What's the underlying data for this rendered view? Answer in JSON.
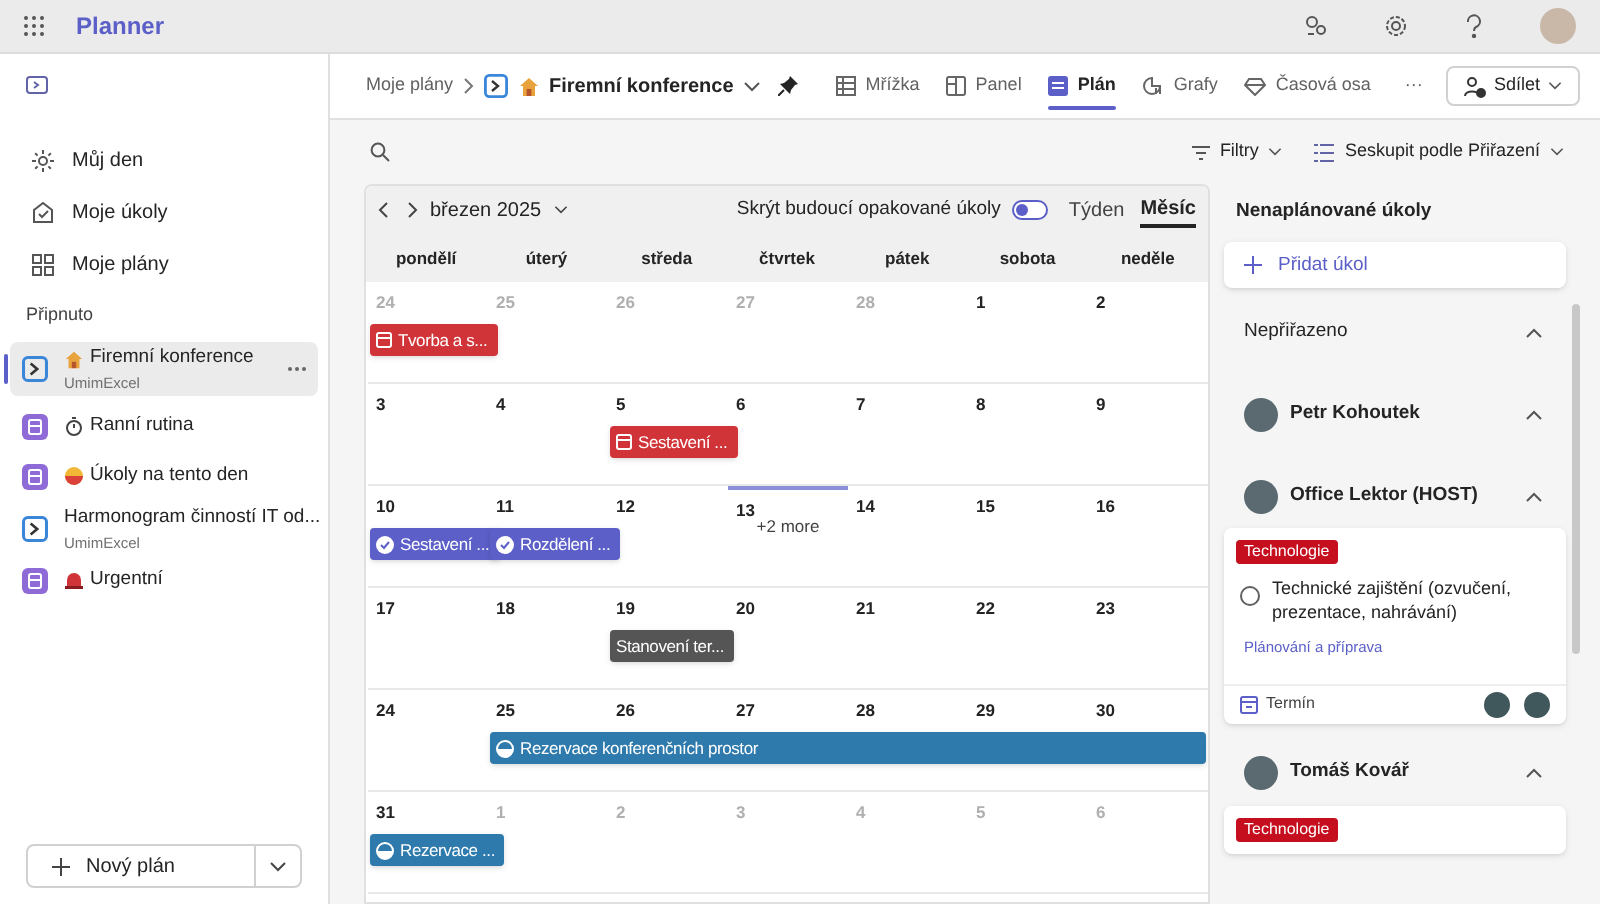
{
  "app": {
    "title": "Planner"
  },
  "sidebar": {
    "nav": [
      {
        "label": "Můj den"
      },
      {
        "label": "Moje úkoly"
      },
      {
        "label": "Moje plány"
      }
    ],
    "pinned_heading": "Připnuto",
    "pinned": [
      {
        "name": "Firemní konference",
        "owner": "UmimExcel",
        "kind": "premium",
        "selected": true
      },
      {
        "name": "Ranní rutina",
        "kind": "basic",
        "selected": false
      },
      {
        "name": "Úkoly na tento den",
        "kind": "basic",
        "selected": false
      },
      {
        "name": "Harmonogram činností IT od...",
        "owner": "UmimExcel",
        "kind": "premium",
        "selected": false
      },
      {
        "name": "Urgentní",
        "kind": "basic",
        "selected": false
      }
    ],
    "new_plan": "Nový plán"
  },
  "header": {
    "breadcrumb_root": "Moje plány",
    "plan_name": "Firemní konference",
    "tabs": [
      {
        "label": "Mřížka",
        "selected": false
      },
      {
        "label": "Panel",
        "selected": false
      },
      {
        "label": "Plán",
        "selected": true
      },
      {
        "label": "Grafy",
        "selected": false
      },
      {
        "label": "Časová osa",
        "selected": false
      }
    ],
    "more": "···",
    "share": "Sdílet"
  },
  "toolbar": {
    "filters": "Filtry",
    "group_by": "Seskupit podle Přiřazení"
  },
  "calendar": {
    "month": "březen 2025",
    "hide_recurring": "Skrýt budoucí opakované úkoly",
    "hide_recurring_on": false,
    "views": [
      {
        "label": "Týden",
        "selected": false
      },
      {
        "label": "Měsíc",
        "selected": true
      }
    ],
    "weekdays": [
      "pondělí",
      "úterý",
      "středa",
      "čtvrtek",
      "pátek",
      "sobota",
      "neděle"
    ],
    "weeks": [
      {
        "days": [
          {
            "n": "24",
            "other_month": true,
            "events": [
              {
                "text": "Tvorba a s...",
                "kind": "calendar",
                "multi_day": false
              }
            ]
          },
          {
            "n": "25",
            "other_month": true
          },
          {
            "n": "26",
            "other_month": true
          },
          {
            "n": "27",
            "other_month": true
          },
          {
            "n": "28",
            "other_month": true
          },
          {
            "n": "1",
            "other_month": false
          },
          {
            "n": "2",
            "other_month": false
          }
        ]
      },
      {
        "days": [
          {
            "n": "3",
            "other_month": false
          },
          {
            "n": "4",
            "other_month": false
          },
          {
            "n": "5",
            "other_month": false,
            "events": [
              {
                "text": "Sestavení ...",
                "kind": "calendar",
                "multi_day": false
              }
            ]
          },
          {
            "n": "6",
            "other_month": false
          },
          {
            "n": "7",
            "other_month": false
          },
          {
            "n": "8",
            "other_month": false
          },
          {
            "n": "9",
            "other_month": false
          }
        ]
      },
      {
        "days": [
          {
            "n": "10",
            "other_month": false,
            "events": [
              {
                "text": "Sestavení ...",
                "kind": "done",
                "multi_day": false
              }
            ]
          },
          {
            "n": "11",
            "other_month": false,
            "events": [
              {
                "text": "Rozdělení ...",
                "kind": "done",
                "multi_day": false
              }
            ]
          },
          {
            "n": "12",
            "other_month": false
          },
          {
            "n": "13",
            "other_month": false,
            "today": true,
            "events": [
              {
                "text": "+2 more",
                "kind": "more",
                "multi_day": false
              }
            ]
          },
          {
            "n": "14",
            "other_month": false
          },
          {
            "n": "15",
            "other_month": false
          },
          {
            "n": "16",
            "other_month": false
          }
        ]
      },
      {
        "days": [
          {
            "n": "17",
            "other_month": false
          },
          {
            "n": "18",
            "other_month": false
          },
          {
            "n": "19",
            "other_month": false,
            "events": [
              {
                "text": "Stanovení ter...",
                "kind": "plain",
                "multi_day": false
              }
            ]
          },
          {
            "n": "20",
            "other_month": false
          },
          {
            "n": "21",
            "other_month": false
          },
          {
            "n": "22",
            "other_month": false
          },
          {
            "n": "23",
            "other_month": false
          }
        ]
      },
      {
        "days": [
          {
            "n": "24",
            "other_month": false
          },
          {
            "n": "25",
            "other_month": false,
            "events": [
              {
                "text": "Rezervace konferenčních prostor",
                "kind": "progress",
                "multi_day": true
              }
            ]
          },
          {
            "n": "26",
            "other_month": false
          },
          {
            "n": "27",
            "other_month": false
          },
          {
            "n": "28",
            "other_month": false
          },
          {
            "n": "29",
            "other_month": false
          },
          {
            "n": "30",
            "other_month": false
          }
        ]
      },
      {
        "days": [
          {
            "n": "31",
            "other_month": false,
            "events": [
              {
                "text": "Rezervace ...",
                "kind": "progress",
                "multi_day": false
              }
            ]
          },
          {
            "n": "1",
            "other_month": true
          },
          {
            "n": "2",
            "other_month": true
          },
          {
            "n": "3",
            "other_month": true
          },
          {
            "n": "4",
            "other_month": true
          },
          {
            "n": "5",
            "other_month": true
          },
          {
            "n": "6",
            "other_month": true
          }
        ]
      }
    ]
  },
  "unscheduled": {
    "title": "Nenaplánované úkoly",
    "add_task": "Přidat úkol",
    "groups": [
      {
        "name": "Nepřiřazeno",
        "kind": "unassigned",
        "expanded": true
      },
      {
        "name": "Petr Kohoutek",
        "kind": "person",
        "expanded": true
      },
      {
        "name": "Office Lektor (HOST)",
        "kind": "person",
        "expanded": true,
        "tasks": [
          {
            "tag": "Technologie",
            "title": "Technické zajištění (ozvučení, prezentace, nahrávání)",
            "checked": false,
            "bucket": "Plánování a příprava",
            "due": "Termín"
          }
        ]
      },
      {
        "name": "Tomáš Kovář",
        "kind": "person",
        "expanded": true,
        "tasks": [
          {
            "tag": "Technologie"
          }
        ]
      }
    ]
  }
}
